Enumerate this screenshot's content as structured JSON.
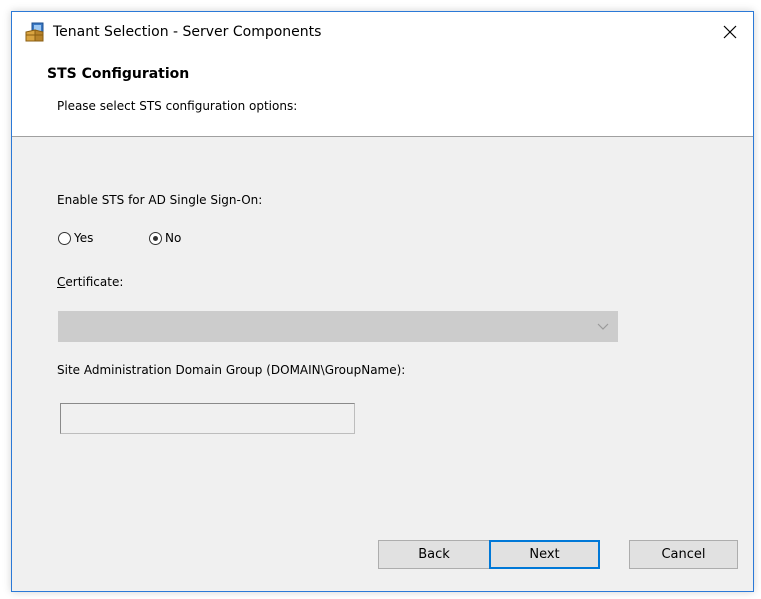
{
  "window": {
    "title": "Tenant Selection - Server Components",
    "icons": {
      "app": "installer-box-icon",
      "close": "close-icon"
    }
  },
  "banner": {
    "title": "STS Configuration",
    "description": "Please select STS configuration options:"
  },
  "sts": {
    "label": "Enable STS for AD Single Sign-On:",
    "options": [
      {
        "label": "Yes",
        "checked": false
      },
      {
        "label": "No",
        "checked": true
      }
    ]
  },
  "certificate": {
    "label_mnemonic": "C",
    "label_rest": "ertificate:",
    "value": "",
    "disabled": true
  },
  "admin_group": {
    "label": "Site Administration Domain Group (DOMAIN\\GroupName):",
    "value": "",
    "disabled": true
  },
  "buttons": {
    "back": "Back",
    "next": "Next",
    "cancel": "Cancel"
  },
  "colors": {
    "accent": "#0078d7",
    "window_border": "#2b79d7",
    "dialog_bg": "#f0f0f0"
  }
}
